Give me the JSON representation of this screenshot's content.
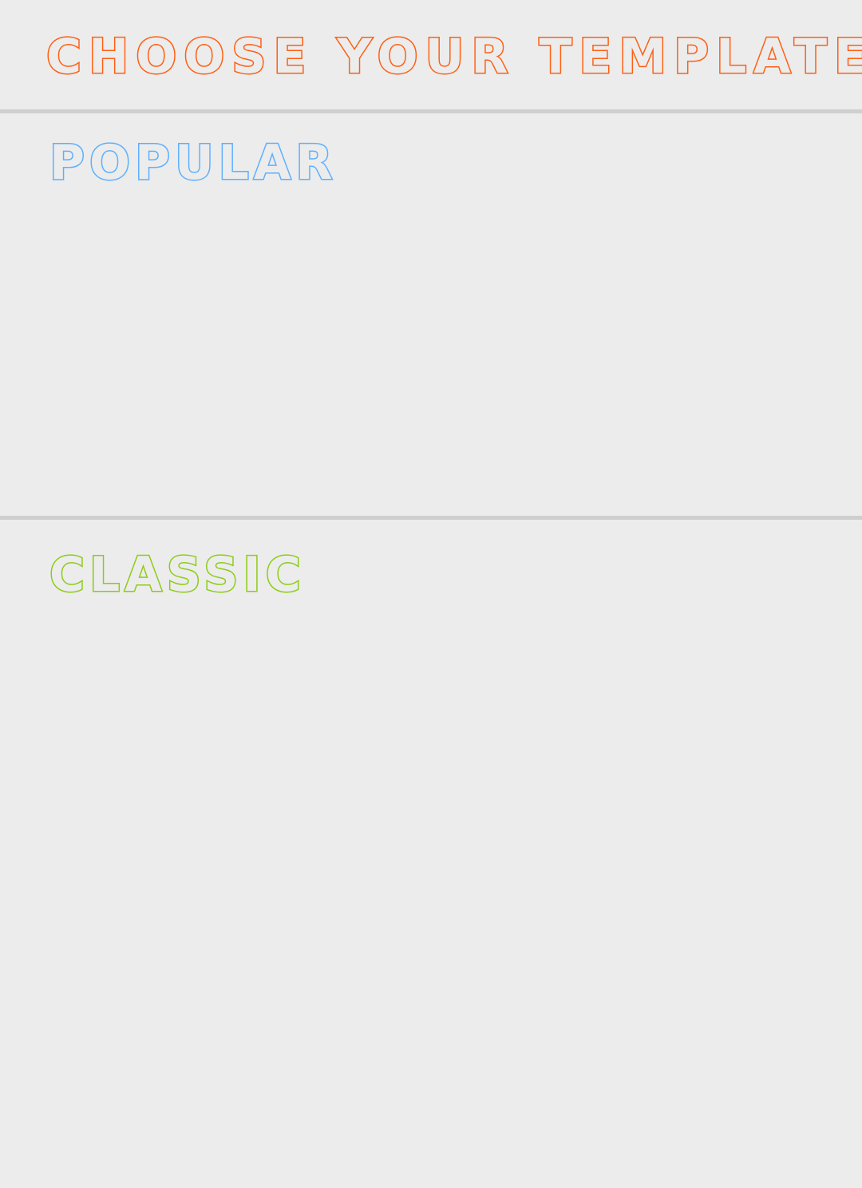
{
  "header": {
    "title": "CHOOSE YOUR TEMPLATE!"
  },
  "sections": {
    "popular": {
      "title": "POPULAR"
    },
    "classic": {
      "title": "CLASSIC"
    }
  },
  "colors": {
    "background": "#ececec",
    "divider": "#cfcfcf",
    "title_accent": "#ff5f12",
    "popular_accent": "#5db0ff",
    "classic_accent": "#8ccc14"
  }
}
